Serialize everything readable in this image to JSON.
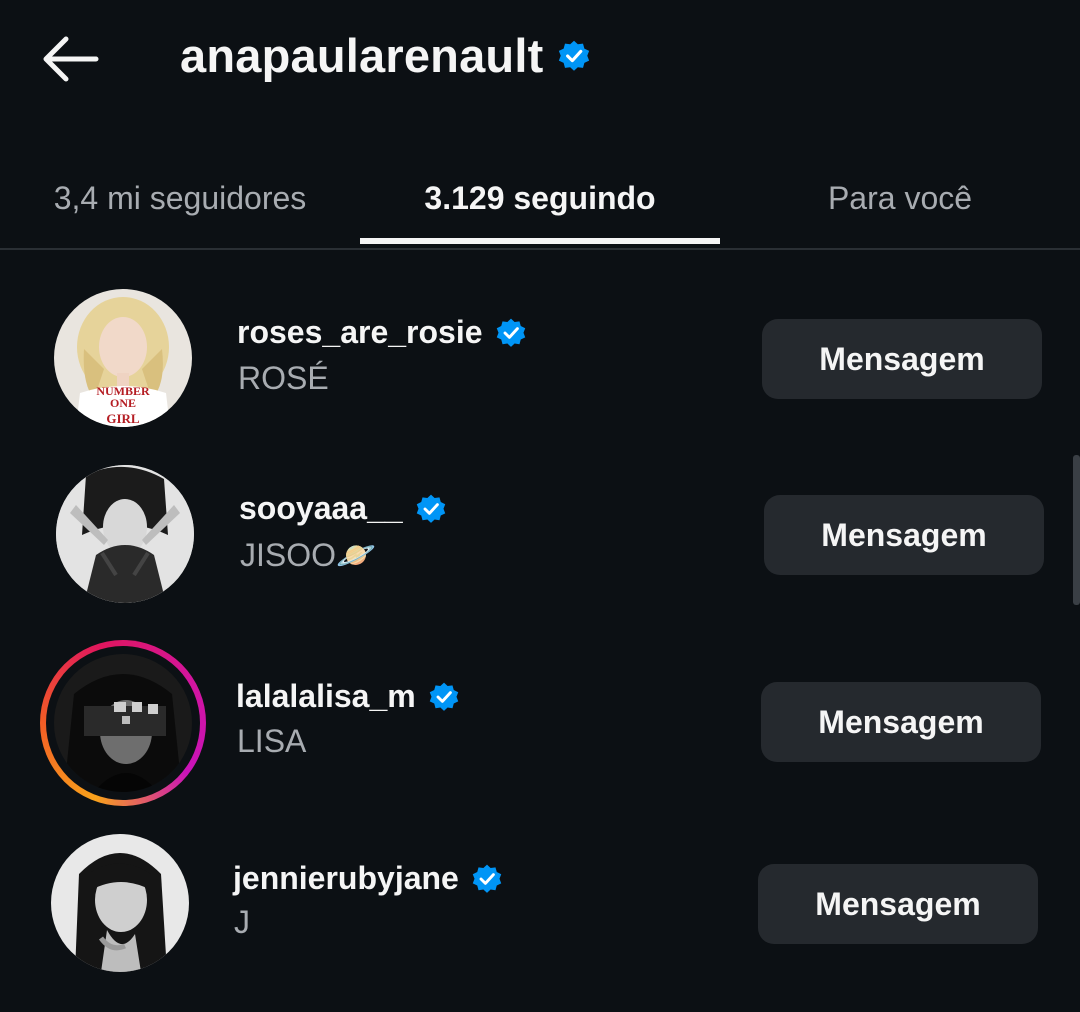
{
  "header": {
    "title": "anapaularenault",
    "verified": true
  },
  "tabs": [
    {
      "label": "3,4 mi seguidores",
      "active": false
    },
    {
      "label": "3.129 seguindo",
      "active": true
    },
    {
      "label": "Para você",
      "active": false
    }
  ],
  "accounts": [
    {
      "username": "roses_are_rosie",
      "full_name": "ROSÉ",
      "verified": true,
      "button": "Mensagem",
      "avatar_shirt_text": [
        "NUMBER",
        "ONE",
        "GIRL"
      ],
      "story_ring": false
    },
    {
      "username": "sooyaaa__",
      "full_name": "JISOO🪐",
      "verified": true,
      "button": "Mensagem",
      "story_ring": false
    },
    {
      "username": "lalalalisa_m",
      "full_name": "LISA",
      "verified": true,
      "button": "Mensagem",
      "story_ring": true
    },
    {
      "username": "jennierubyjane",
      "full_name": "J",
      "verified": true,
      "button": "Mensagem",
      "story_ring": false
    }
  ],
  "colors": {
    "background": "#0c1014",
    "button": "#25292e",
    "verified": "#0095f6",
    "muted_text": "#a8acb1"
  }
}
